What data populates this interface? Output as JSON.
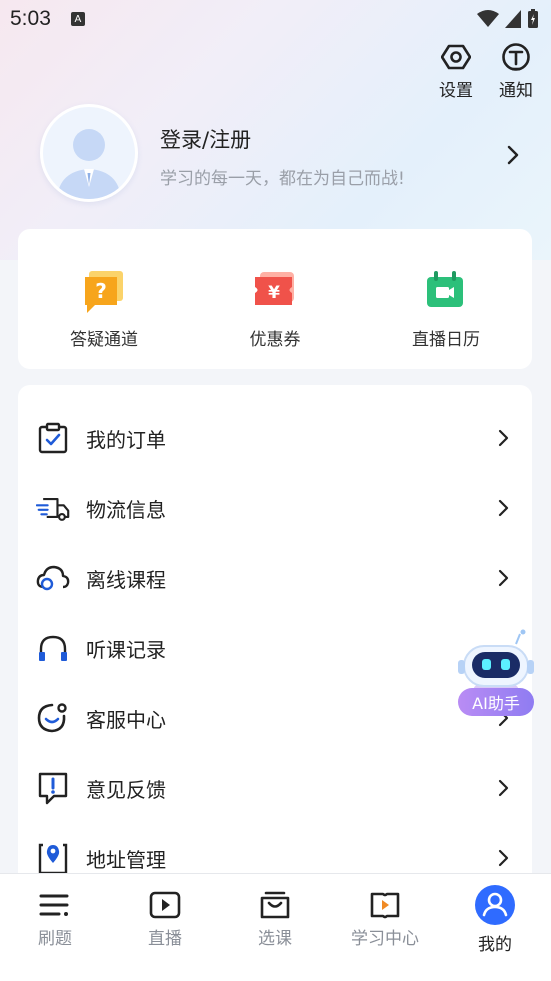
{
  "status_bar": {
    "time": "5:03",
    "notification_letter": "A"
  },
  "header": {
    "settings_label": "设置",
    "notifications_label": "通知"
  },
  "profile": {
    "login_label": "登录/注册",
    "motto": "学习的每一天，都在为自己而战!"
  },
  "quick_actions": [
    {
      "label": "答疑通道",
      "icon": "question-bubble-icon",
      "color": "#f7a51c"
    },
    {
      "label": "优惠券",
      "icon": "coupon-icon",
      "color": "#f0524a"
    },
    {
      "label": "直播日历",
      "icon": "live-calendar-icon",
      "color": "#2cc07a"
    }
  ],
  "menu": [
    {
      "label": "我的订单",
      "icon": "order-clipboard-icon"
    },
    {
      "label": "物流信息",
      "icon": "delivery-truck-icon"
    },
    {
      "label": "离线课程",
      "icon": "offline-cloud-icon"
    },
    {
      "label": "听课记录",
      "icon": "headphones-icon"
    },
    {
      "label": "客服中心",
      "icon": "customer-service-icon"
    },
    {
      "label": "意见反馈",
      "icon": "feedback-icon"
    },
    {
      "label": "地址管理",
      "icon": "location-pin-icon"
    }
  ],
  "ai_helper": {
    "label": "AI助手"
  },
  "tabbar": {
    "active": "我的",
    "tabs": [
      {
        "label": "刷题",
        "icon": "list-icon"
      },
      {
        "label": "直播",
        "icon": "play-icon"
      },
      {
        "label": "选课",
        "icon": "shopping-bag-icon"
      },
      {
        "label": "学习中心",
        "icon": "book-play-icon"
      },
      {
        "label": "我的",
        "icon": "user-icon"
      }
    ]
  },
  "colors": {
    "accent": "#2f6bff",
    "brand_blue": "#1f5bd8"
  }
}
